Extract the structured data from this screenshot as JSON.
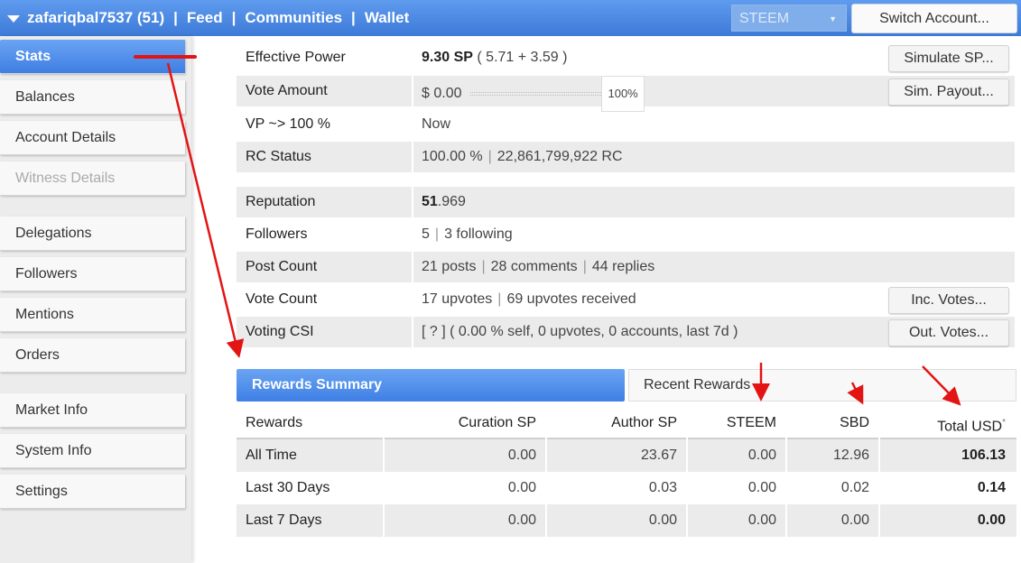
{
  "header": {
    "username": "zafariqbal7537 (51)",
    "nav": [
      "Feed",
      "Communities",
      "Wallet"
    ],
    "chain_select": "STEEM",
    "switch_account": "Switch Account..."
  },
  "sidebar": {
    "items": [
      {
        "label": "Stats"
      },
      {
        "label": "Balances"
      },
      {
        "label": "Account Details"
      },
      {
        "label": "Witness Details"
      },
      {
        "label": "Delegations"
      },
      {
        "label": "Followers"
      },
      {
        "label": "Mentions"
      },
      {
        "label": "Orders"
      },
      {
        "label": "Market Info"
      },
      {
        "label": "System Info"
      },
      {
        "label": "Settings"
      }
    ]
  },
  "stats": {
    "effective_power": {
      "label": "Effective Power",
      "value": "9.30 SP",
      "detail": "( 5.71 + 3.59 )",
      "button": "Simulate SP..."
    },
    "vote_amount": {
      "label": "Vote Amount",
      "value": "$ 0.00",
      "percent": "100%",
      "button": "Sim. Payout..."
    },
    "vp": {
      "label": "VP ~> 100 %",
      "value": "Now"
    },
    "rc_status": {
      "label": "RC Status",
      "percent": "100.00 %",
      "rc": "22,861,799,922 RC"
    },
    "reputation": {
      "label": "Reputation",
      "int": "51",
      "frac": ".969"
    },
    "followers": {
      "label": "Followers",
      "count": "5",
      "following": "3 following"
    },
    "post_count": {
      "label": "Post Count",
      "posts": "21 posts",
      "comments": "28 comments",
      "replies": "44 replies"
    },
    "vote_count": {
      "label": "Vote Count",
      "upvotes": "17 upvotes",
      "received": "69 upvotes received",
      "button": "Inc. Votes..."
    },
    "voting_csi": {
      "label": "Voting CSI",
      "value": "[ ? ] ( 0.00 % self, 0 upvotes, 0 accounts, last 7d )",
      "button": "Out. Votes..."
    }
  },
  "rewards": {
    "tabs": [
      "Rewards Summary",
      "Recent Rewards"
    ],
    "headers": [
      "Rewards",
      "Curation SP",
      "Author SP",
      "STEEM",
      "SBD",
      "Total USD"
    ],
    "header_mark": "*",
    "rows": [
      {
        "label": "All Time",
        "curation": "0.00",
        "author": "23.67",
        "steem": "0.00",
        "sbd": "12.96",
        "total": "106.13"
      },
      {
        "label": "Last 30 Days",
        "curation": "0.00",
        "author": "0.03",
        "steem": "0.00",
        "sbd": "0.02",
        "total": "0.14"
      },
      {
        "label": "Last 7 Days",
        "curation": "0.00",
        "author": "0.00",
        "steem": "0.00",
        "sbd": "0.00",
        "total": "0.00"
      }
    ]
  },
  "annotation_color": "#e21414"
}
